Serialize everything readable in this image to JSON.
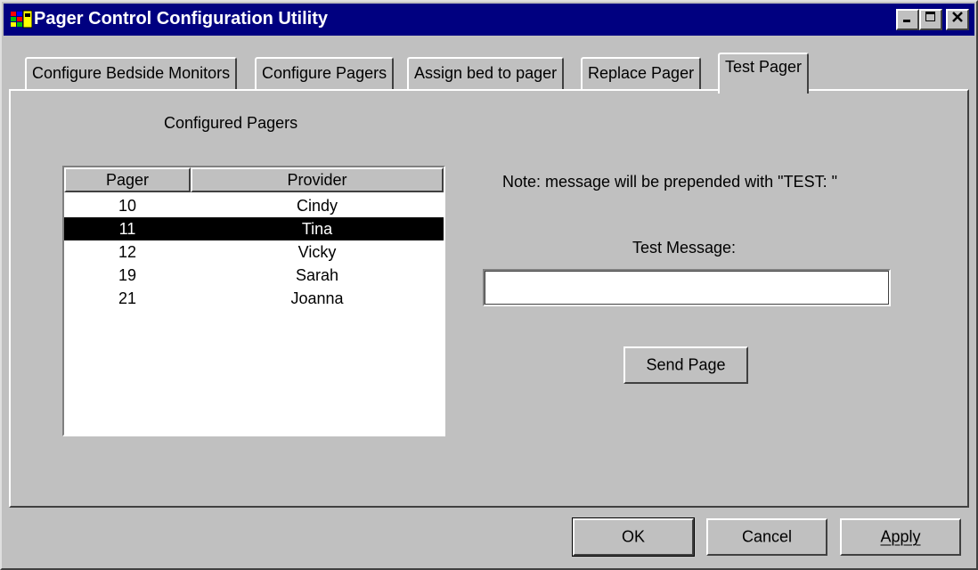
{
  "window": {
    "title": "Pager Control Configuration Utility",
    "controls": {
      "minimize": "_",
      "maximize": "□",
      "close": "×"
    }
  },
  "tabs": [
    {
      "label": "Configure Bedside Monitors",
      "active": false
    },
    {
      "label": "Configure Pagers",
      "active": false
    },
    {
      "label": "Assign bed to pager",
      "active": false
    },
    {
      "label": "Replace Pager",
      "active": false
    },
    {
      "label": "Test Pager",
      "active": true
    }
  ],
  "left": {
    "heading": "Configured Pagers",
    "columns": [
      "Pager",
      "Provider"
    ],
    "rows": [
      {
        "pager": "10",
        "provider": "Cindy",
        "selected": false
      },
      {
        "pager": "11",
        "provider": "Tina",
        "selected": true
      },
      {
        "pager": "12",
        "provider": "Vicky",
        "selected": false
      },
      {
        "pager": "19",
        "provider": "Sarah",
        "selected": false
      },
      {
        "pager": "21",
        "provider": "Joanna",
        "selected": false
      }
    ]
  },
  "right": {
    "note": "Note: message will be prepended with \"TEST: \"",
    "message_label": "Test Message:",
    "message_value": "",
    "send_label": "Send Page"
  },
  "footer": {
    "ok_label": "OK",
    "cancel_label": "Cancel",
    "apply_label": "Apply"
  },
  "colors": {
    "titlebar": "#000080",
    "face": "#c0c0c0",
    "selection": "#000000"
  }
}
